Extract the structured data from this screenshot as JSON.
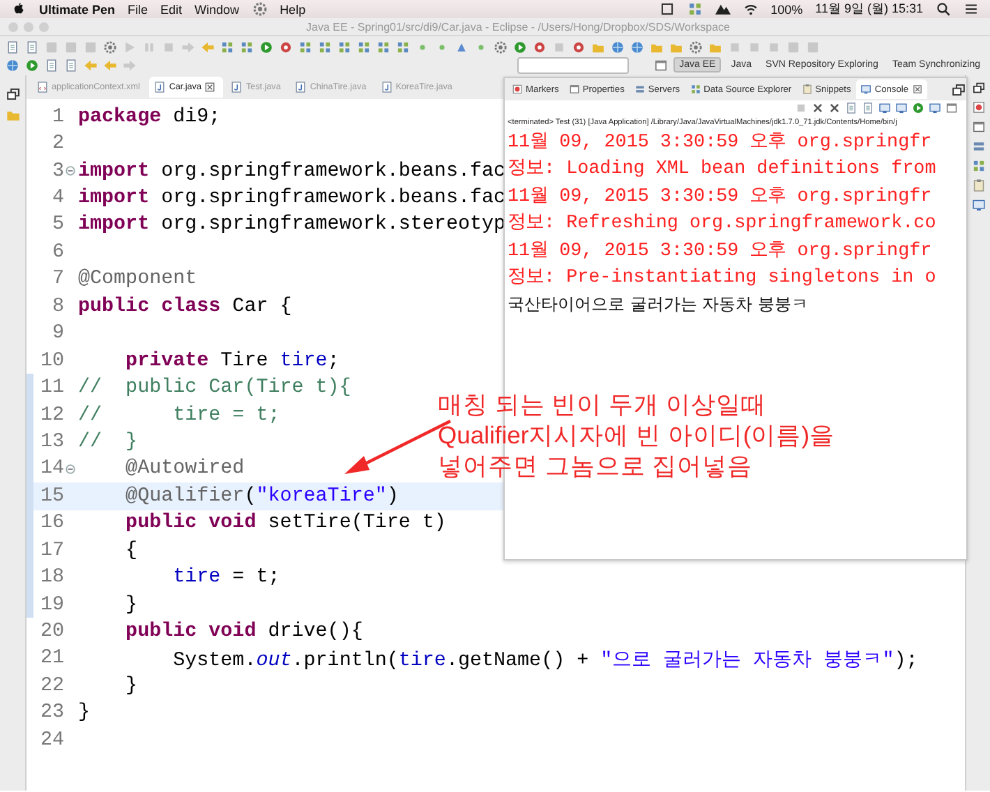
{
  "menubar": {
    "app_name": "Ultimate Pen",
    "menus": [
      "File",
      "Edit",
      "Window"
    ],
    "help_menu": "Help",
    "battery": "100%",
    "clock": "11월 9일 (월) 15:31"
  },
  "window": {
    "title": "Java EE - Spring01/src/di9/Car.java - Eclipse - /Users/Hong/Dropbox/SDS/Workspace"
  },
  "perspectives": [
    {
      "label": "Java EE",
      "selected": true
    },
    {
      "label": "Java",
      "selected": false
    },
    {
      "label": "SVN Repository Exploring",
      "selected": false
    },
    {
      "label": "Team Synchronizing",
      "selected": false
    }
  ],
  "editor_tabs": [
    {
      "label": "applicationContext.xml",
      "selected": false
    },
    {
      "label": "Car.java",
      "selected": true
    },
    {
      "label": "Test.java",
      "selected": false
    },
    {
      "label": "ChinaTire.java",
      "selected": false
    },
    {
      "label": "KoreaTire.java",
      "selected": false
    }
  ],
  "code_lines": [
    {
      "number": "1",
      "current": false,
      "changed": false,
      "fold": false,
      "segments": [
        {
          "kind": "keyword",
          "text": "package"
        },
        {
          "kind": "plain",
          "text": " di9;"
        }
      ]
    },
    {
      "number": "2",
      "current": false,
      "changed": false,
      "fold": false
    },
    {
      "number": "3",
      "current": false,
      "changed": false,
      "fold": true,
      "segments": [
        {
          "kind": "keyword",
          "text": "import"
        },
        {
          "kind": "plain",
          "text": " org.springframework.beans.fac"
        }
      ]
    },
    {
      "number": "4",
      "current": false,
      "changed": false,
      "fold": false,
      "segments": [
        {
          "kind": "keyword",
          "text": "import"
        },
        {
          "kind": "plain",
          "text": " org.springframework.beans.fac"
        }
      ]
    },
    {
      "number": "5",
      "current": false,
      "changed": false,
      "fold": false,
      "segments": [
        {
          "kind": "keyword",
          "text": "import"
        },
        {
          "kind": "plain",
          "text": " org.springframework.stereotyp"
        }
      ]
    },
    {
      "number": "6",
      "current": false,
      "changed": false,
      "fold": false
    },
    {
      "number": "7",
      "current": false,
      "changed": false,
      "fold": false,
      "segments": [
        {
          "kind": "annotation",
          "text": "@Component"
        }
      ]
    },
    {
      "number": "8",
      "current": false,
      "changed": false,
      "fold": false,
      "segments": [
        {
          "kind": "keyword",
          "text": "public class"
        },
        {
          "kind": "plain",
          "text": " Car {"
        }
      ]
    },
    {
      "number": "9",
      "current": false,
      "changed": false,
      "fold": false
    },
    {
      "number": "10",
      "current": false,
      "changed": false,
      "fold": false,
      "segments": [
        {
          "kind": "keyword",
          "text": "    private"
        },
        {
          "kind": "plain",
          "text": " Tire "
        },
        {
          "kind": "field",
          "text": "tire"
        },
        {
          "kind": "plain",
          "text": ";"
        }
      ]
    },
    {
      "number": "11",
      "current": false,
      "changed": true,
      "fold": false,
      "segments": [
        {
          "kind": "comment",
          "text": "//  public Car(Tire t){"
        }
      ]
    },
    {
      "number": "12",
      "current": false,
      "changed": true,
      "fold": false,
      "segments": [
        {
          "kind": "comment",
          "text": "//      tire = t;"
        }
      ]
    },
    {
      "number": "13",
      "current": false,
      "changed": true,
      "fold": false,
      "segments": [
        {
          "kind": "comment",
          "text": "//  }"
        }
      ]
    },
    {
      "number": "14",
      "current": false,
      "changed": true,
      "fold": true,
      "segments": [
        {
          "kind": "annotation",
          "text": "    @Autowired"
        }
      ]
    },
    {
      "number": "15",
      "current": true,
      "changed": true,
      "fold": false,
      "segments": [
        {
          "kind": "annotation",
          "text": "    @Qualifier"
        },
        {
          "kind": "plain",
          "text": "("
        },
        {
          "kind": "string",
          "text": "\"koreaTire\""
        },
        {
          "kind": "plain",
          "text": ")"
        }
      ]
    },
    {
      "number": "16",
      "current": false,
      "changed": true,
      "fold": false,
      "segments": [
        {
          "kind": "keyword",
          "text": "    public void"
        },
        {
          "kind": "plain",
          "text": " setTire(Tire t)"
        }
      ]
    },
    {
      "number": "17",
      "current": false,
      "changed": true,
      "fold": false,
      "segments": [
        {
          "kind": "plain",
          "text": "    {"
        }
      ]
    },
    {
      "number": "18",
      "current": false,
      "changed": true,
      "fold": false,
      "segments": [
        {
          "kind": "field",
          "text": "        tire"
        },
        {
          "kind": "plain",
          "text": " = t;"
        }
      ]
    },
    {
      "number": "19",
      "current": false,
      "changed": true,
      "fold": false,
      "segments": [
        {
          "kind": "plain",
          "text": "    }"
        }
      ]
    },
    {
      "number": "20",
      "current": false,
      "changed": false,
      "fold": false,
      "segments": [
        {
          "kind": "keyword",
          "text": "    public void"
        },
        {
          "kind": "plain",
          "text": " drive(){"
        }
      ]
    },
    {
      "number": "21",
      "current": false,
      "changed": false,
      "fold": false,
      "segments": [
        {
          "kind": "plain",
          "text": "        System."
        },
        {
          "kind": "static",
          "text": "out"
        },
        {
          "kind": "plain",
          "text": ".println("
        },
        {
          "kind": "field",
          "text": "tire"
        },
        {
          "kind": "plain",
          "text": ".getName() + "
        },
        {
          "kind": "string",
          "text": "\"으로 굴러가는 자동차 붕붕ㅋ\""
        },
        {
          "kind": "plain",
          "text": ");"
        }
      ]
    },
    {
      "number": "22",
      "current": false,
      "changed": false,
      "fold": false,
      "segments": [
        {
          "kind": "plain",
          "text": "    }"
        }
      ]
    },
    {
      "number": "23",
      "current": false,
      "changed": false,
      "fold": false,
      "segments": [
        {
          "kind": "plain",
          "text": "}"
        }
      ]
    },
    {
      "number": "24",
      "current": false,
      "changed": false,
      "fold": false
    }
  ],
  "annotation": {
    "lines": [
      "매칭 되는 빈이 두개 이상일때",
      "Qualifier지시자에 빈 아이디(이름)을",
      "넣어주면 그놈으로 집어넣음"
    ]
  },
  "console_panel": {
    "tabs": [
      {
        "label": "Markers",
        "selected": false
      },
      {
        "label": "Properties",
        "selected": false
      },
      {
        "label": "Servers",
        "selected": false
      },
      {
        "label": "Data Source Explorer",
        "selected": false
      },
      {
        "label": "Snippets",
        "selected": false
      },
      {
        "label": "Console",
        "selected": true
      }
    ],
    "status": "<terminated> Test (31) [Java Application] /Library/Java/JavaVirtualMachines/jdk1.7.0_71.jdk/Contents/Home/bin/j",
    "lines": [
      {
        "kind": "error",
        "text": "11월 09, 2015 3:30:59 오후 org.springfr"
      },
      {
        "kind": "error",
        "text": "정보: Loading XML bean definitions from"
      },
      {
        "kind": "error",
        "text": "11월 09, 2015 3:30:59 오후 org.springfr"
      },
      {
        "kind": "error",
        "text": "정보: Refreshing org.springframework.co"
      },
      {
        "kind": "error",
        "text": "11월 09, 2015 3:30:59 오후 org.springfr"
      },
      {
        "kind": "error",
        "text": "정보: Pre-instantiating singletons in o"
      },
      {
        "kind": "output",
        "text": "국산타이어으로 굴러가는 자동차 붕붕ㅋ"
      }
    ]
  }
}
